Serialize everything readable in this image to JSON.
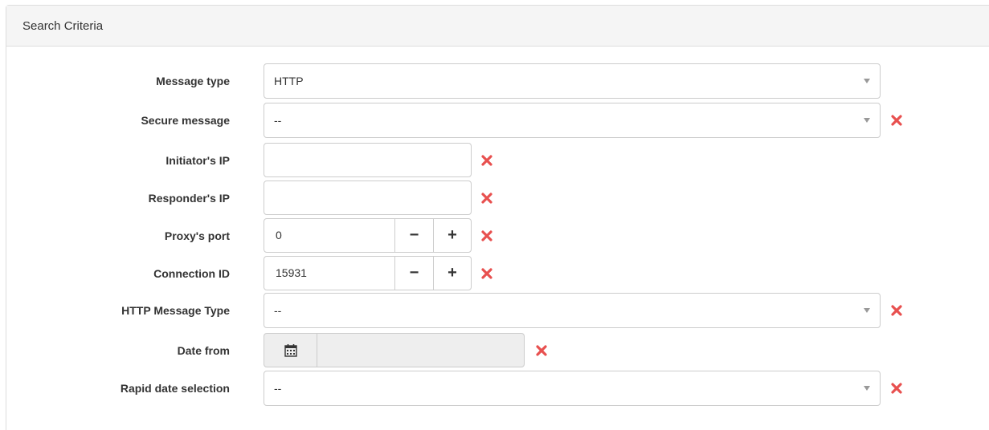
{
  "panel": {
    "title": "Search Criteria"
  },
  "colors": {
    "clear_icon": "#e8504f",
    "border": "#cccccc",
    "heading_bg": "#f5f5f5"
  },
  "fields": {
    "message_type": {
      "label": "Message type",
      "value": "HTTP",
      "icon": "chevron-down-icon"
    },
    "secure_message": {
      "label": "Secure message",
      "value": "--",
      "icon": "chevron-down-icon"
    },
    "initiator_ip": {
      "label": "Initiator's IP",
      "value": ""
    },
    "responder_ip": {
      "label": "Responder's IP",
      "value": ""
    },
    "proxy_port": {
      "label": "Proxy's port",
      "value": "0",
      "minus": "−",
      "plus": "+"
    },
    "connection_id": {
      "label": "Connection ID",
      "value": "15931",
      "minus": "−",
      "plus": "+"
    },
    "http_message_type": {
      "label": "HTTP Message Type",
      "value": "--",
      "icon": "chevron-down-icon"
    },
    "date_from": {
      "label": "Date from",
      "value": "",
      "icon": "calendar-icon"
    },
    "rapid_date_selection": {
      "label": "Rapid date selection",
      "value": "--",
      "icon": "chevron-down-icon"
    }
  }
}
